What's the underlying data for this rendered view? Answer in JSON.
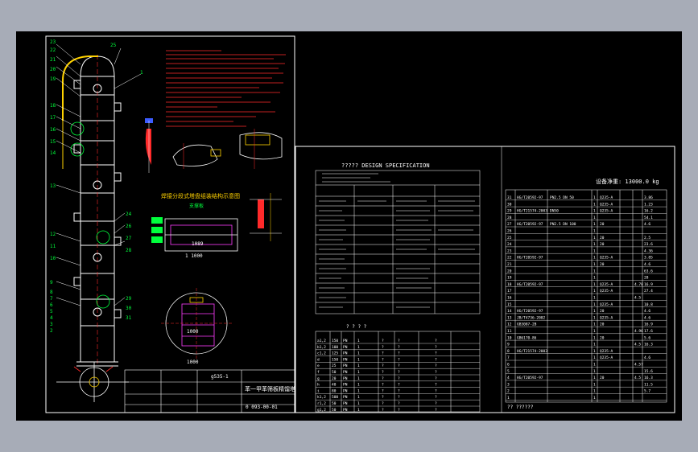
{
  "colors": {
    "background": "#a7acb7",
    "viewport": "#000000",
    "border": "#ffffff",
    "main_line": "#ffffff",
    "red": "#ff2a2a",
    "green": "#00ff3c",
    "yellow": "#ffd200",
    "magenta": "#ff3cff",
    "cyan": "#35e0ff",
    "blue": "#3c5cff"
  },
  "labels": {
    "spec_title": "????? DESIGN SPECIFICATION",
    "total_weight": "设备净重: 13000.0  kg",
    "sheet_code": "g535-1",
    "sheet_number": "0 093-00-01",
    "title_block_name": "苯一甲苯筛板精馏塔",
    "detail_title": "焊接分段式塔盘组装结构示意图",
    "detail_subtitle": "支撑板",
    "dim_1": "1 1000",
    "dim_2": "1089",
    "dim_3": "1000",
    "dim_4": "1000",
    "parts_footer": "??  ??????",
    "spec_table_footer": "?       ?      ?       ?",
    "callout_right": "1"
  },
  "callouts_left": [
    "23",
    "22",
    "21",
    "20",
    "19",
    "18",
    "17",
    "16",
    "15",
    "14",
    "13",
    "12",
    "11",
    "10",
    "9",
    "8",
    "7",
    "6",
    "5",
    "4",
    "3",
    "2"
  ],
  "callouts_right": [
    "25",
    "24",
    "26",
    "27",
    "28",
    "29",
    "30",
    "31"
  ],
  "nozzle_rows": [
    [
      "a1,2",
      "150",
      "PN",
      "1",
      "?",
      "?",
      "?"
    ],
    [
      "b1,2",
      "100",
      "PN",
      "1",
      "?",
      "?",
      "?"
    ],
    [
      "c1,2",
      "125",
      "PN",
      "1",
      "?",
      "?",
      "?"
    ],
    [
      "d",
      "150",
      "PN",
      "1",
      "?",
      "?",
      "?"
    ],
    [
      "e",
      "25",
      "PN",
      "1",
      "?",
      "?",
      "?"
    ],
    [
      "f",
      "50",
      "PN",
      "1",
      "?",
      "?",
      "?"
    ],
    [
      "g",
      "20",
      "PN",
      "1",
      "?",
      "?",
      "?"
    ],
    [
      "h",
      "40",
      "PN",
      "1",
      "?",
      "?",
      "?"
    ],
    [
      "i",
      "80",
      "PN",
      "1",
      "?",
      "?",
      "?"
    ],
    [
      "k1,2",
      "500",
      "PN",
      "1",
      "?",
      "?",
      "?"
    ],
    [
      "r1,2",
      "50",
      "PN",
      "1",
      "?",
      "?",
      "?"
    ],
    [
      "g1,2",
      "50",
      "PN",
      "1",
      "?",
      "?",
      "?"
    ]
  ],
  "parts_rows": [
    [
      "31",
      "HG/T20592-97",
      "PN2.5 DN 50",
      "1",
      "Q235-A",
      "",
      "3.86"
    ],
    [
      "30",
      "",
      "",
      "1",
      "Q235-A",
      "",
      "1.23"
    ],
    [
      "29",
      "HG/T21574-2003",
      "DN50",
      "1",
      "Q235-A",
      "",
      "16.2"
    ],
    [
      "28",
      "",
      "",
      "1",
      "",
      "",
      "54.1"
    ],
    [
      "27",
      "HG/T20592-97",
      "PN2.5 DN 100",
      "1",
      "20",
      "",
      "4.6"
    ],
    [
      "26",
      "",
      "",
      "1",
      "",
      "",
      ""
    ],
    [
      "25",
      "",
      "",
      "1",
      "20",
      "",
      "2.5"
    ],
    [
      "24",
      "",
      "",
      "1",
      "20",
      "",
      "23.6"
    ],
    [
      "23",
      "",
      "",
      "1",
      "",
      "",
      "4.36"
    ],
    [
      "22",
      "HG/T20592-97",
      "",
      "1",
      "Q235-A",
      "",
      "3.85"
    ],
    [
      "21",
      "",
      "",
      "1",
      "20",
      "",
      "4.6"
    ],
    [
      "20",
      "",
      "",
      "1",
      "",
      "",
      "63.6"
    ],
    [
      "19",
      "",
      "",
      "1",
      "",
      "",
      "28"
    ],
    [
      "18",
      "HG/T20592-97",
      "",
      "1",
      "Q235-A",
      "4.78",
      "16.9"
    ],
    [
      "17",
      "",
      "",
      "1",
      "Q235-A",
      "",
      "27.4"
    ],
    [
      "16",
      "",
      "",
      "1",
      "",
      "4.5",
      ""
    ],
    [
      "15",
      "",
      "",
      "1",
      "Q235-A",
      "",
      "10.8"
    ],
    [
      "14",
      "HG/T20592-97",
      "",
      "1",
      "20",
      "",
      "4.6"
    ],
    [
      "13",
      "JB/T4736-2002",
      "",
      "1",
      "Q235-A",
      "",
      "4.6"
    ],
    [
      "12",
      "GB3087-2B",
      "",
      "1",
      "20",
      "",
      "16.9"
    ],
    [
      "11",
      "",
      "",
      "1",
      "",
      "4.96",
      "17.6"
    ],
    [
      "10",
      "GB6170-86",
      "",
      "1",
      "20",
      "",
      "5.6"
    ],
    [
      "9",
      "",
      "",
      "1",
      "",
      "4.5",
      "16.3"
    ],
    [
      "8",
      "HG/T21574-2003",
      "",
      "1",
      "Q235-A",
      "",
      ""
    ],
    [
      "7",
      "",
      "",
      "1",
      "Q235-A",
      "",
      "4.6"
    ],
    [
      "6",
      "",
      "",
      "1",
      "",
      "4.57",
      ""
    ],
    [
      "5",
      "",
      "",
      "1",
      "",
      "",
      "15.6"
    ],
    [
      "4",
      "HG/T20592-97",
      "",
      "1",
      "20",
      "4.5",
      "16.3"
    ],
    [
      "3",
      "",
      "",
      "1",
      "",
      "",
      "11.5"
    ],
    [
      "2",
      "",
      "",
      "1",
      "",
      "",
      "5.7"
    ],
    [
      "1",
      "",
      "",
      "1",
      "",
      "",
      ""
    ]
  ]
}
